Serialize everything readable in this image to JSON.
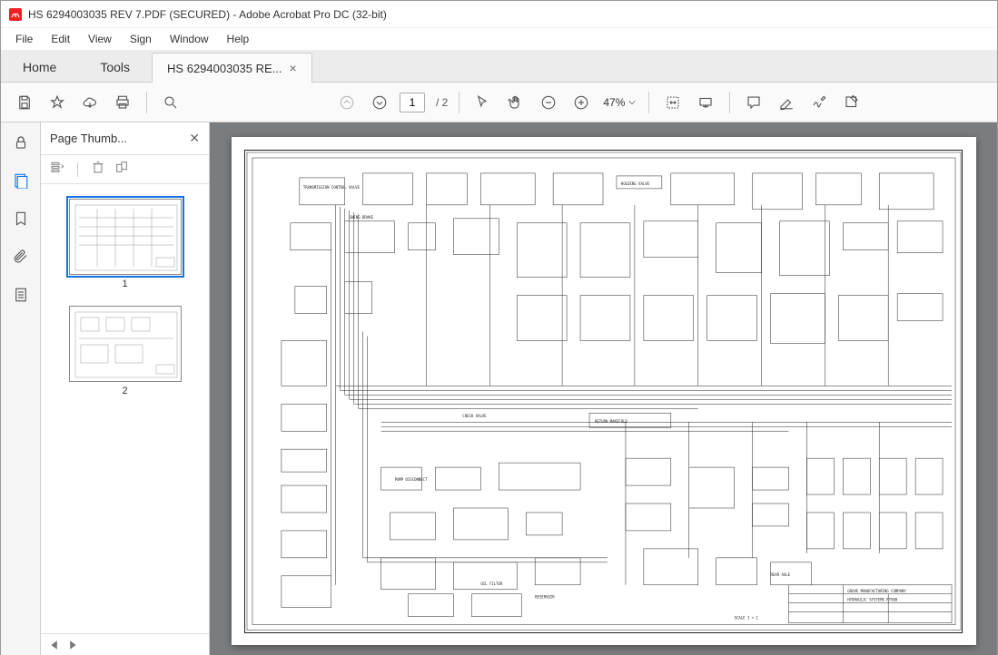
{
  "window": {
    "title": "HS 6294003035 REV 7.PDF (SECURED) - Adobe Acrobat Pro DC (32-bit)"
  },
  "menu": {
    "file": "File",
    "edit": "Edit",
    "view": "View",
    "sign": "Sign",
    "window": "Window",
    "help": "Help"
  },
  "tabs": {
    "home": "Home",
    "tools": "Tools",
    "doc": "HS 6294003035 RE..."
  },
  "toolbar": {
    "page_current": "1",
    "page_total": "/ 2",
    "zoom": "47%"
  },
  "thumbnails": {
    "title": "Page Thumb...",
    "page1": "1",
    "page2": "2"
  },
  "schematic": {
    "return_manifold": "RETURN MANIFOLD",
    "swing_brake": "SWING BRAKE",
    "check_valve": "CHECK VALVE",
    "oil_filter": "OIL FILTER",
    "pump_disconnect": "PUMP DISCONNECT",
    "reservoir": "RESERVOIR",
    "rear_axle": "REAR AXLE",
    "transmission": "TRANSMISSION CONTROL VALVE",
    "holding_valve": "HOLDING VALVE",
    "company": "GROVE MANUFACTURING COMPANY",
    "drawing_title": "HYDRAULIC SYSTEMS  RT900",
    "scale": "SCALE 1 = 1"
  }
}
